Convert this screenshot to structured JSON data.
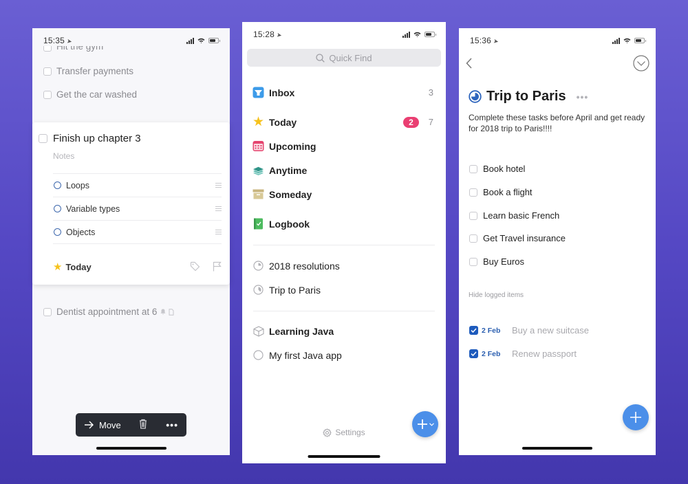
{
  "background": {
    "gradient_top": "#6a5fd3",
    "gradient_bottom": "#4337ad"
  },
  "phone1": {
    "status_time": "15:35",
    "faded_tasks": [
      {
        "title": "Hit the gym"
      },
      {
        "title": "Transfer payments"
      },
      {
        "title": "Get the car washed"
      }
    ],
    "expanded_task": {
      "title": "Finish up chapter 3",
      "notes_placeholder": "Notes",
      "checklist": [
        {
          "label": "Loops"
        },
        {
          "label": "Variable types"
        },
        {
          "label": "Objects"
        }
      ],
      "when_label": "Today",
      "icons": [
        "tag-icon",
        "flag-icon"
      ]
    },
    "after_tasks": [
      {
        "title": "Dentist appointment at 6",
        "icons": [
          "reminder-bell-icon",
          "note-icon"
        ]
      }
    ],
    "toolbar": {
      "move_label": "Move",
      "delete_icon": "trash-icon",
      "more_icon": "more-icon"
    }
  },
  "phone2": {
    "status_time": "15:28",
    "search_placeholder": "Quick Find",
    "nav": [
      {
        "label": "Inbox",
        "icon": "inbox-icon",
        "count": "3",
        "color": "#3d9be9"
      },
      {
        "label": "Today",
        "icon": "star-icon",
        "badge": "2",
        "count": "7",
        "color": "#f6c21c"
      },
      {
        "label": "Upcoming",
        "icon": "calendar-icon",
        "color": "#e5456f"
      },
      {
        "label": "Anytime",
        "icon": "layers-icon",
        "color": "#3aa49a"
      },
      {
        "label": "Someday",
        "icon": "archive-box-icon",
        "color": "#c8b57e"
      },
      {
        "label": "Logbook",
        "icon": "logbook-icon",
        "color": "#4dbb5f"
      }
    ],
    "projects": [
      {
        "label": "2018 resolutions",
        "icon": "project-progress-icon"
      },
      {
        "label": "Trip to Paris",
        "icon": "project-progress-icon"
      }
    ],
    "area": {
      "label": "Learning Java",
      "icon": "area-cube-icon"
    },
    "area_projects": [
      {
        "label": "My first Java app",
        "icon": "project-circle-icon"
      }
    ],
    "settings_label": "Settings",
    "accent_color": "#4b8fe9"
  },
  "phone3": {
    "status_time": "15:36",
    "project_title": "Trip to Paris",
    "project_progress": 0.3,
    "description": "Complete these tasks before April and get ready for 2018 trip to Paris!!!!",
    "tasks": [
      {
        "title": "Book hotel",
        "done": false
      },
      {
        "title": "Book a flight",
        "done": false
      },
      {
        "title": "Learn basic French",
        "done": false
      },
      {
        "title": "Get Travel insurance",
        "done": false
      },
      {
        "title": "Buy Euros",
        "done": false
      }
    ],
    "hide_logged_label": "Hide logged items",
    "logged": [
      {
        "date": "2 Feb",
        "title": "Buy a new suitcase",
        "done": true
      },
      {
        "date": "2 Feb",
        "title": "Renew passport",
        "done": true
      }
    ]
  }
}
